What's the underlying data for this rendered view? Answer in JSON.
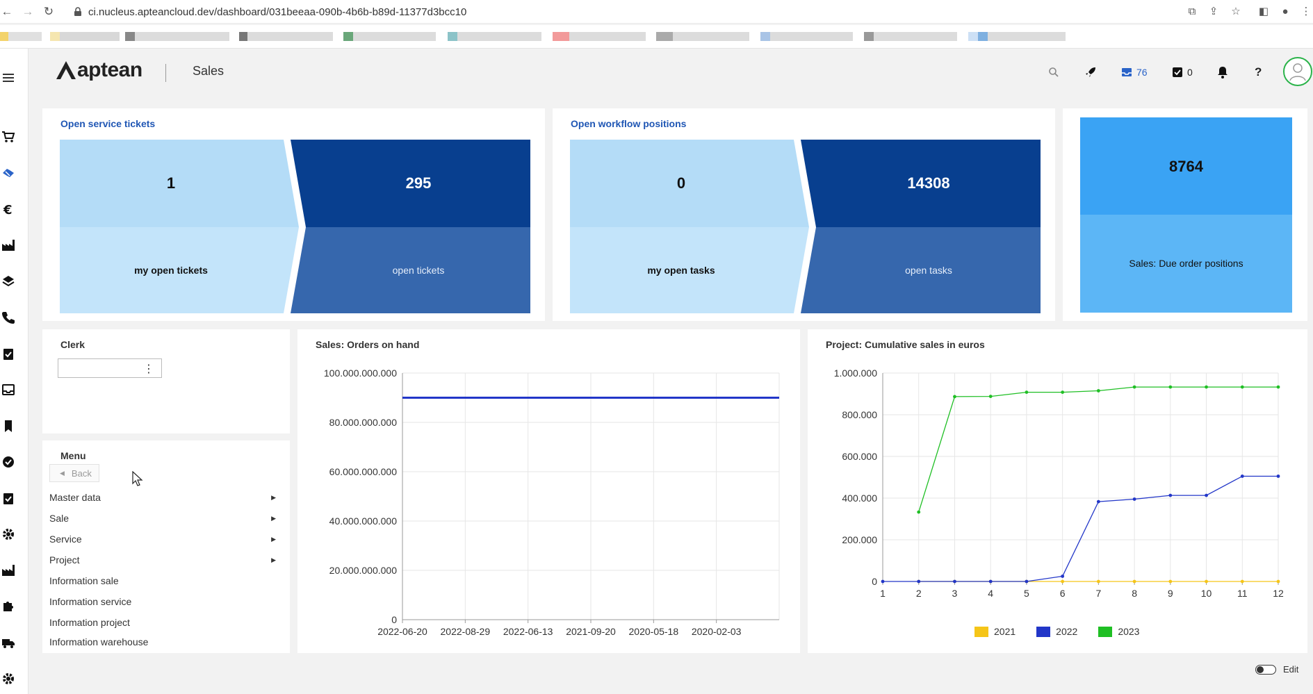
{
  "browser": {
    "url": "ci.nucleus.apteancloud.dev/dashboard/031beeaa-090b-4b6b-b89d-11377d3bcc10"
  },
  "header": {
    "logo_text": "aptean",
    "title": "Sales",
    "inbox_count": "76",
    "tasks_count": "0",
    "help_label": "?"
  },
  "service_tickets": {
    "title": "Open service tickets",
    "my_value": "1",
    "my_label": "my open tickets",
    "all_value": "295",
    "all_label": "open tickets"
  },
  "workflow": {
    "title": "Open workflow positions",
    "my_value": "0",
    "my_label": "my open tasks",
    "all_value": "14308",
    "all_label": "open tasks"
  },
  "due_orders": {
    "value": "8764",
    "label": "Sales: Due order positions"
  },
  "clerk": {
    "title": "Clerk",
    "selected": ""
  },
  "menu": {
    "title": "Menu",
    "back_label": "Back",
    "items": [
      {
        "label": "Master data",
        "has_submenu": true
      },
      {
        "label": "Sale",
        "has_submenu": true
      },
      {
        "label": "Service",
        "has_submenu": true
      },
      {
        "label": "Project",
        "has_submenu": true
      },
      {
        "label": "Information sale",
        "has_submenu": false
      },
      {
        "label": "Information service",
        "has_submenu": false
      },
      {
        "label": "Information project",
        "has_submenu": false
      },
      {
        "label": "Information warehouse",
        "has_submenu": false
      }
    ]
  },
  "footer": {
    "edit_label": "Edit"
  },
  "chart_data": [
    {
      "type": "line",
      "title": "Sales: Orders on hand",
      "x": [
        "2022-06-20",
        "2022-08-29",
        "2022-06-13",
        "2021-09-20",
        "2020-05-18",
        "2020-02-03"
      ],
      "y_ticks": [
        "0",
        "20.000.000.000",
        "40.000.000.000",
        "60.000.000.000",
        "80.000.000.000",
        "100.000.000.000"
      ],
      "ylim": [
        0,
        100000000000
      ],
      "series": [
        {
          "name": "",
          "color": "#2236c8",
          "values": [
            90000000000,
            90000000000,
            90000000000,
            90000000000,
            90000000000,
            90000000000
          ]
        }
      ],
      "grid": true
    },
    {
      "type": "line",
      "title": "Project: Cumulative sales in euros",
      "x": [
        1,
        2,
        3,
        4,
        5,
        6,
        7,
        8,
        9,
        10,
        11,
        12
      ],
      "y_ticks": [
        "0",
        "200.000",
        "400.000",
        "600.000",
        "800.000",
        "1.000.000"
      ],
      "ylim": [
        0,
        1000000
      ],
      "series": [
        {
          "name": "2021",
          "color": "#f5c518",
          "values": [
            null,
            0,
            0,
            0,
            0,
            0,
            0,
            0,
            0,
            0,
            0,
            0
          ]
        },
        {
          "name": "2022",
          "color": "#2236c8",
          "values": [
            0,
            0,
            0,
            0,
            0,
            25000,
            383000,
            395000,
            413000,
            413000,
            505000,
            505000
          ]
        },
        {
          "name": "2023",
          "color": "#1fbf24",
          "values": [
            null,
            333000,
            887000,
            888000,
            908000,
            908000,
            915000,
            933000,
            933000,
            933000,
            933000,
            933000
          ]
        }
      ],
      "legend": "bottom",
      "grid": true
    }
  ]
}
